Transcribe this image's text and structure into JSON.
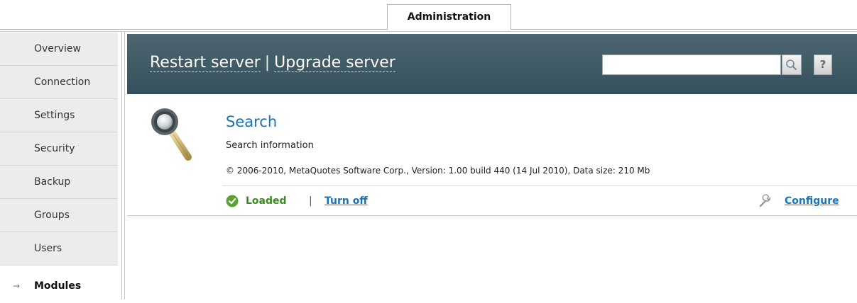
{
  "tabs": {
    "active": "Administration"
  },
  "sidebar": {
    "items": [
      {
        "label": "Overview"
      },
      {
        "label": "Connection"
      },
      {
        "label": "Settings"
      },
      {
        "label": "Security"
      },
      {
        "label": "Backup"
      },
      {
        "label": "Groups"
      },
      {
        "label": "Users"
      },
      {
        "label": "Modules",
        "active": true,
        "marker": "→"
      }
    ]
  },
  "header": {
    "restart_label": "Restart server",
    "separator": "|",
    "upgrade_label": "Upgrade server",
    "search_value": "",
    "search_icon": "magnifier-icon",
    "help_label": "?"
  },
  "module": {
    "icon": "magnifier-icon",
    "title": "Search",
    "description": "Search information",
    "meta": "© 2006-2010, MetaQuotes Software Corp.,  Version: 1.00 build 440 (14 Jul 2010), Data size: 210 Mb",
    "status_icon": "check-circle-icon",
    "status": "Loaded",
    "separator": "|",
    "action": "Turn off",
    "configure_icon": "wrench-icon",
    "configure": "Configure"
  },
  "colors": {
    "header_bg": "#3f5a66",
    "link": "#1a73b8",
    "loaded_green": "#3c8a1f"
  }
}
